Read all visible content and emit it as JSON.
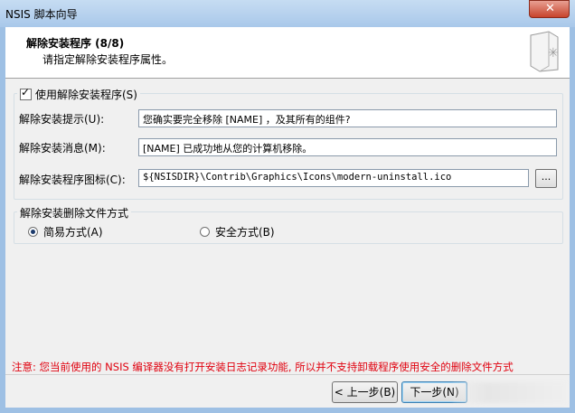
{
  "window": {
    "title": "NSIS 脚本向导",
    "close_label": "✕"
  },
  "header": {
    "title": "解除安装程序 (8/8)",
    "subtitle": "请指定解除安装程序属性。"
  },
  "uninstaller_group": {
    "checkbox_label": "使用解除安装程序(S)",
    "checked": true,
    "prompt_label": "解除安装提示(U):",
    "prompt_value": "您确实要完全移除 [NAME] ，及其所有的组件?",
    "message_label": "解除安装消息(M):",
    "message_value": "[NAME] 已成功地从您的计算机移除。",
    "icon_label": "解除安装程序图标(C):",
    "icon_value": "${NSISDIR}\\Contrib\\Graphics\\Icons\\modern-uninstall.ico",
    "browse_label": "..."
  },
  "delete_mode_group": {
    "legend": "解除安装删除文件方式",
    "options": [
      {
        "label": "简易方式(A)",
        "selected": true
      },
      {
        "label": "安全方式(B)",
        "selected": false
      }
    ]
  },
  "warning_text": "注意: 您当前使用的 NSIS 编译器没有打开安装日志记录功能, 所以并不支持卸载程序使用安全的删除文件方式",
  "buttons": {
    "back": "< 上一步(B)",
    "next": "下一步(N)"
  },
  "colors": {
    "warning": "#e0000e",
    "accent": "#3c7fb1"
  }
}
